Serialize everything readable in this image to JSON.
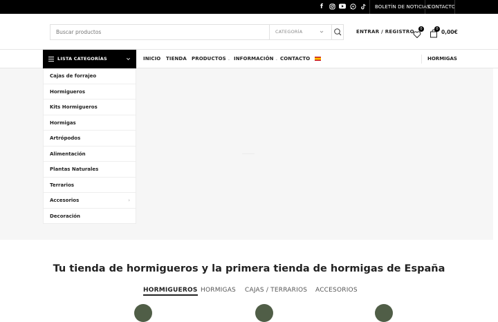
{
  "topbar": {
    "social_icons": [
      "facebook-icon",
      "instagram-icon",
      "youtube-icon",
      "whatsapp-icon",
      "tiktok-icon"
    ],
    "links": [
      "BOLETÍN DE NOTICIAS",
      "CONTACTO"
    ]
  },
  "header": {
    "search_placeholder": "Buscar productos",
    "category_label": "CATEGORÍA",
    "login_label": "ENTRAR / REGISTRO",
    "wishlist_count": "0",
    "cart_count": "0",
    "cart_total": "0,00€"
  },
  "nav": {
    "categories_button": "LISTA CATEGORÍAS",
    "items": [
      "INICIO",
      "TIENDA",
      "PRODUCTOS",
      "INFORMACIÓN",
      "CONTACTO"
    ],
    "right_link": "HORMIGAS"
  },
  "categories_menu": [
    "Cajas de forrajeo",
    "Hormigueros",
    "Kits Hormigueros",
    "Hormigas",
    "Artrópodos",
    "Alimentación",
    "Plantas Naturales",
    "Terrarios",
    "Accesorios",
    "Decoración"
  ],
  "section": {
    "headline": "Tu tienda de hormigueros y la primera tienda de hormigas de España",
    "tabs": [
      "HORMIGUEROS",
      "HORMIGAS",
      "CAJAS / TERRARIOS",
      "ACCESORIOS"
    ],
    "active_tab": "HORMIGUEROS"
  },
  "colors": {
    "topbar": "#000000",
    "hero_bg": "#f6f6f6",
    "icon_circle": "#505e47"
  }
}
